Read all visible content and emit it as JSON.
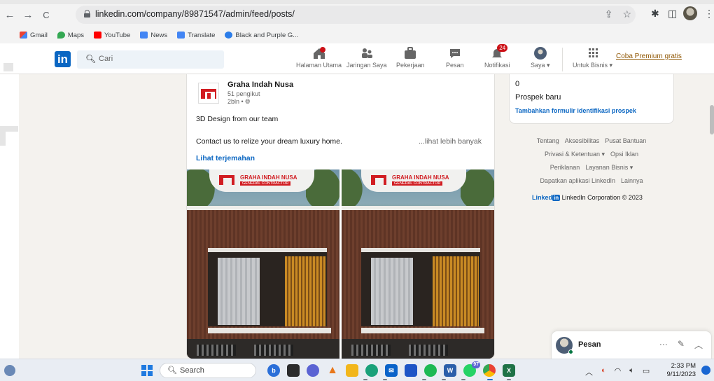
{
  "browser": {
    "url": "linkedin.com/company/89871547/admin/feed/posts/",
    "bookmarks": [
      "Gmail",
      "Maps",
      "YouTube",
      "News",
      "Translate",
      "Black and Purple G..."
    ]
  },
  "linkedin_header": {
    "logo": "in",
    "search_placeholder": "Cari",
    "nav": [
      {
        "label": "Halaman Utama",
        "icon": "home-icon"
      },
      {
        "label": "Jaringan Saya",
        "icon": "network-icon"
      },
      {
        "label": "Pekerjaan",
        "icon": "briefcase-icon"
      },
      {
        "label": "Pesan",
        "icon": "messaging-icon"
      },
      {
        "label": "Notifikasi",
        "icon": "bell-icon",
        "badge": "24"
      },
      {
        "label": "Saya ▾",
        "icon": "avatar-icon"
      },
      {
        "label": "Untuk Bisnis ▾",
        "icon": "grid-icon"
      }
    ],
    "premium": "Coba Premium gratis"
  },
  "post": {
    "company": "Graha Indah Nusa",
    "followers": "51 pengikut",
    "time": "2bln •",
    "line1": "3D Design from our team",
    "line2": "Contact us to relize your dream luxury home.",
    "see_more": "...lihat lebih banyak",
    "translate": "Lihat terjemahan",
    "image_sign_title": "GRAHA INDAH NUSA",
    "image_sign_subtitle": "GENERAL CONTRACTOR"
  },
  "right_rail": {
    "leads_count": "0",
    "leads_label": "Prospek baru",
    "leads_link": "Tambahkan formulir identifikasi prospek"
  },
  "footer": {
    "row1": [
      "Tentang",
      "Aksesibilitas",
      "Pusat Bantuan"
    ],
    "row2": [
      "Privasi & Ketentuan ▾",
      "Opsi Iklan"
    ],
    "row3": [
      "Periklanan",
      "Layanan Bisnis ▾"
    ],
    "row4": [
      "Dapatkan aplikasi LinkedIn",
      "Lainnya"
    ],
    "brand": "Linked",
    "brand_in": "in",
    "corp": "LinkedIn Corporation © 2023"
  },
  "messaging": {
    "label": "Pesan"
  },
  "taskbar": {
    "search": "Search",
    "clock_time": "2:33 PM",
    "clock_date": "9/11/2023",
    "badge_97": "97",
    "apps": [
      "bing-icon",
      "file-explorer-icon",
      "teams-icon",
      "vlc-icon",
      "folder-icon",
      "edge-icon",
      "mail-icon",
      "store-icon",
      "spotify-icon",
      "word-icon",
      "whatsapp-icon",
      "chrome-icon",
      "excel-icon"
    ]
  }
}
